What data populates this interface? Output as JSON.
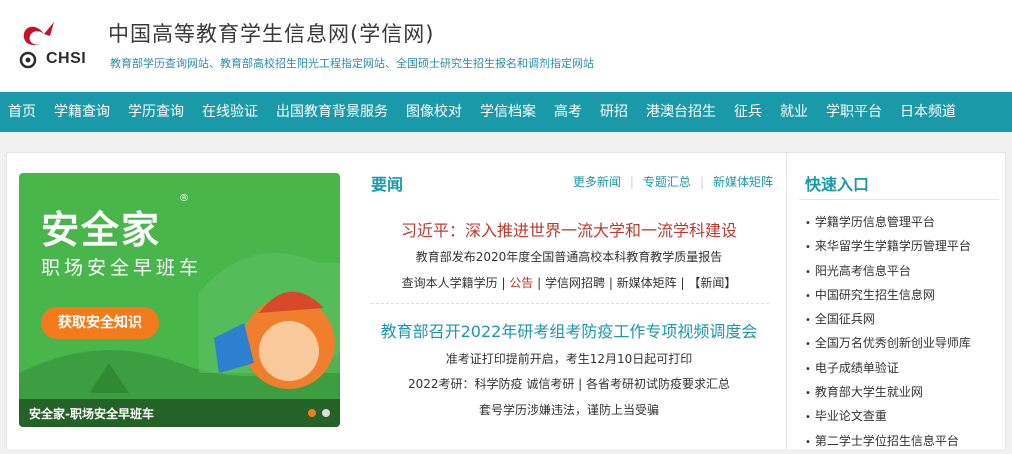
{
  "header": {
    "logo_text": "CHSI",
    "title": "中国高等教育学生信息网(学信网)",
    "subtitle": "教育部学历查询网站、教育部高校招生阳光工程指定网站、全国硕士研究生招生报名和调剂指定网站"
  },
  "nav": {
    "items": [
      "首页",
      "学籍查询",
      "学历查询",
      "在线验证",
      "出国教育背景服务",
      "图像校对",
      "学信档案",
      "高考",
      "研招",
      "港澳台招生",
      "征兵",
      "就业",
      "学职平台",
      "日本频道"
    ]
  },
  "banner": {
    "title": "安全家",
    "reg_mark": "®",
    "subtitle": "职场安全早班车",
    "button": "获取安全知识",
    "caption": "安全家-职场安全早班车",
    "accent_color": "#49b64c",
    "button_color": "#f47b1c"
  },
  "news": {
    "heading": "要闻",
    "links": [
      "更多新闻",
      "专题汇总",
      "新媒体矩阵"
    ],
    "headline1": "习近平：深入推进世界一流大学和一流学科建设",
    "line1": "教育部发布2020年度全国普通高校本科教育教学质量报告",
    "line2": {
      "a": "查询本人学籍学历",
      "b": "公告",
      "c": "学信网招聘",
      "d": "新媒体矩阵",
      "e": "【新闻】"
    },
    "headline2": "教育部召开2022年研考组考防疫工作专项视频调度会",
    "line3": "准考证打印提前开启，考生12月10日起可打印",
    "line4": "2022考研：科学防疫 诚信考研 | 各省考研初试防疫要求汇总",
    "line5": "套号学历涉嫌违法，谨防上当受骗"
  },
  "quick": {
    "heading": "快速入口",
    "items": [
      "学籍学历信息管理平台",
      "来华留学生学籍学历管理平台",
      "阳光高考信息平台",
      "中国研究生招生信息网",
      "全国征兵网",
      "全国万名优秀创新创业导师库",
      "电子成绩单验证",
      "教育部大学生就业网",
      "毕业论文查重",
      "第二学士学位招生信息平台"
    ]
  },
  "colors": {
    "brand": "#1a9aa8",
    "headline_red": "#c0392b"
  }
}
